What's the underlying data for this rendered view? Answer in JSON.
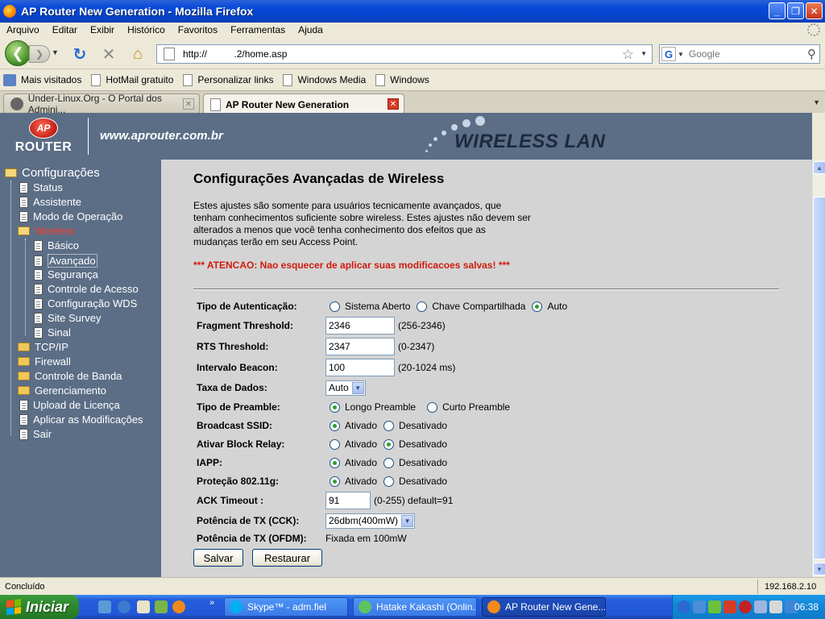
{
  "window": {
    "title": "AP Router New Generation - Mozilla Firefox"
  },
  "menu": [
    "Arquivo",
    "Editar",
    "Exibir",
    "Histórico",
    "Favoritos",
    "Ferramentas",
    "Ajuda"
  ],
  "nav": {
    "url": "http://          .2/home.asp",
    "search_placeholder": "Google",
    "search_engine": "G"
  },
  "bookmarks": [
    "Mais visitados",
    "HotMail gratuito",
    "Personalizar links",
    "Windows Media",
    "Windows"
  ],
  "tabs": [
    {
      "label": "Under-Linux.Org - O Portal dos Admini...",
      "active": false
    },
    {
      "label": "AP Router New Generation",
      "active": true
    }
  ],
  "header": {
    "logo_text": "ROUTER",
    "logo_mark": "AP",
    "site_url": "www.aprouter.com.br",
    "banner": "WIRELESS LAN"
  },
  "sidebar": {
    "root": "Configurações",
    "items": [
      {
        "label": "Status"
      },
      {
        "label": "Assistente"
      },
      {
        "label": "Modo de Operação"
      },
      {
        "label": "Wireless"
      },
      {
        "label": "Básico"
      },
      {
        "label": "Avançado"
      },
      {
        "label": "Segurança"
      },
      {
        "label": "Controle de Acesso"
      },
      {
        "label": "Configuração WDS"
      },
      {
        "label": "Site Survey"
      },
      {
        "label": "Sinal"
      },
      {
        "label": "TCP/IP"
      },
      {
        "label": "Firewall"
      },
      {
        "label": "Controle de Banda"
      },
      {
        "label": "Gerenciamento"
      },
      {
        "label": "Upload de Licença"
      },
      {
        "label": "Aplicar as Modificações"
      },
      {
        "label": "Sair"
      }
    ]
  },
  "page": {
    "title": "Configurações Avançadas de Wireless",
    "description": "Estes ajustes são somente para usuários tecnicamente avançados, que tenham conhecimentos suficiente sobre wireless. Estes ajustes não devem ser alterados a menos que você tenha conhecimento dos efeitos que as mudanças terão em seu Access Point.",
    "warning": "*** ATENCAO: Nao esquecer de aplicar suas modificacoes salvas! ***"
  },
  "form": {
    "auth": {
      "label": "Tipo de Autenticação:",
      "options": [
        "Sistema Aberto",
        "Chave Compartilhada",
        "Auto"
      ],
      "selected": "Auto"
    },
    "fragment": {
      "label": "Fragment Threshold:",
      "value": "2346",
      "hint": "(256-2346)"
    },
    "rts": {
      "label": "RTS Threshold:",
      "value": "2347",
      "hint": "(0-2347)"
    },
    "beacon": {
      "label": "Intervalo Beacon:",
      "value": "100",
      "hint": "(20-1024 ms)"
    },
    "rate": {
      "label": "Taxa de Dados:",
      "value": "Auto"
    },
    "preamble": {
      "label": "Tipo de Preamble:",
      "options": [
        "Longo Preamble",
        "Curto Preamble"
      ],
      "selected": "Longo Preamble"
    },
    "ssid": {
      "label": "Broadcast SSID:",
      "options": [
        "Ativado",
        "Desativado"
      ],
      "selected": "Ativado"
    },
    "block_relay": {
      "label": "Ativar Block Relay:",
      "options": [
        "Ativado",
        "Desativado"
      ],
      "selected": "Desativado"
    },
    "iapp": {
      "label": "IAPP:",
      "options": [
        "Ativado",
        "Desativado"
      ],
      "selected": "Ativado"
    },
    "protection": {
      "label": "Proteção 802.11g:",
      "options": [
        "Ativado",
        "Desativado"
      ],
      "selected": "Ativado"
    },
    "ack": {
      "label": "ACK Timeout :",
      "value": "91",
      "hint": "(0-255) default=91"
    },
    "tx_cck": {
      "label": "Potência de TX (CCK):",
      "value": "26dbm(400mW)"
    },
    "tx_ofdm": {
      "label": "Potência de TX (OFDM):",
      "value": "Fixada em 100mW"
    },
    "save_label": "Salvar",
    "reset_label": "Restaurar"
  },
  "status": {
    "left": "Concluído",
    "right": "192.168.2.10"
  },
  "taskbar": {
    "start": "Iniciar",
    "buttons": [
      "Skype™ - adm.fiel",
      "Hatake Kakashi (Onlin...",
      "AP Router New Gene..."
    ],
    "clock": "06:38"
  },
  "colors": {
    "site_bg": "#5b6e86",
    "content_bg": "#d4d4d4",
    "warning": "#d11a0c",
    "active_nav": "#ff3b2a"
  }
}
